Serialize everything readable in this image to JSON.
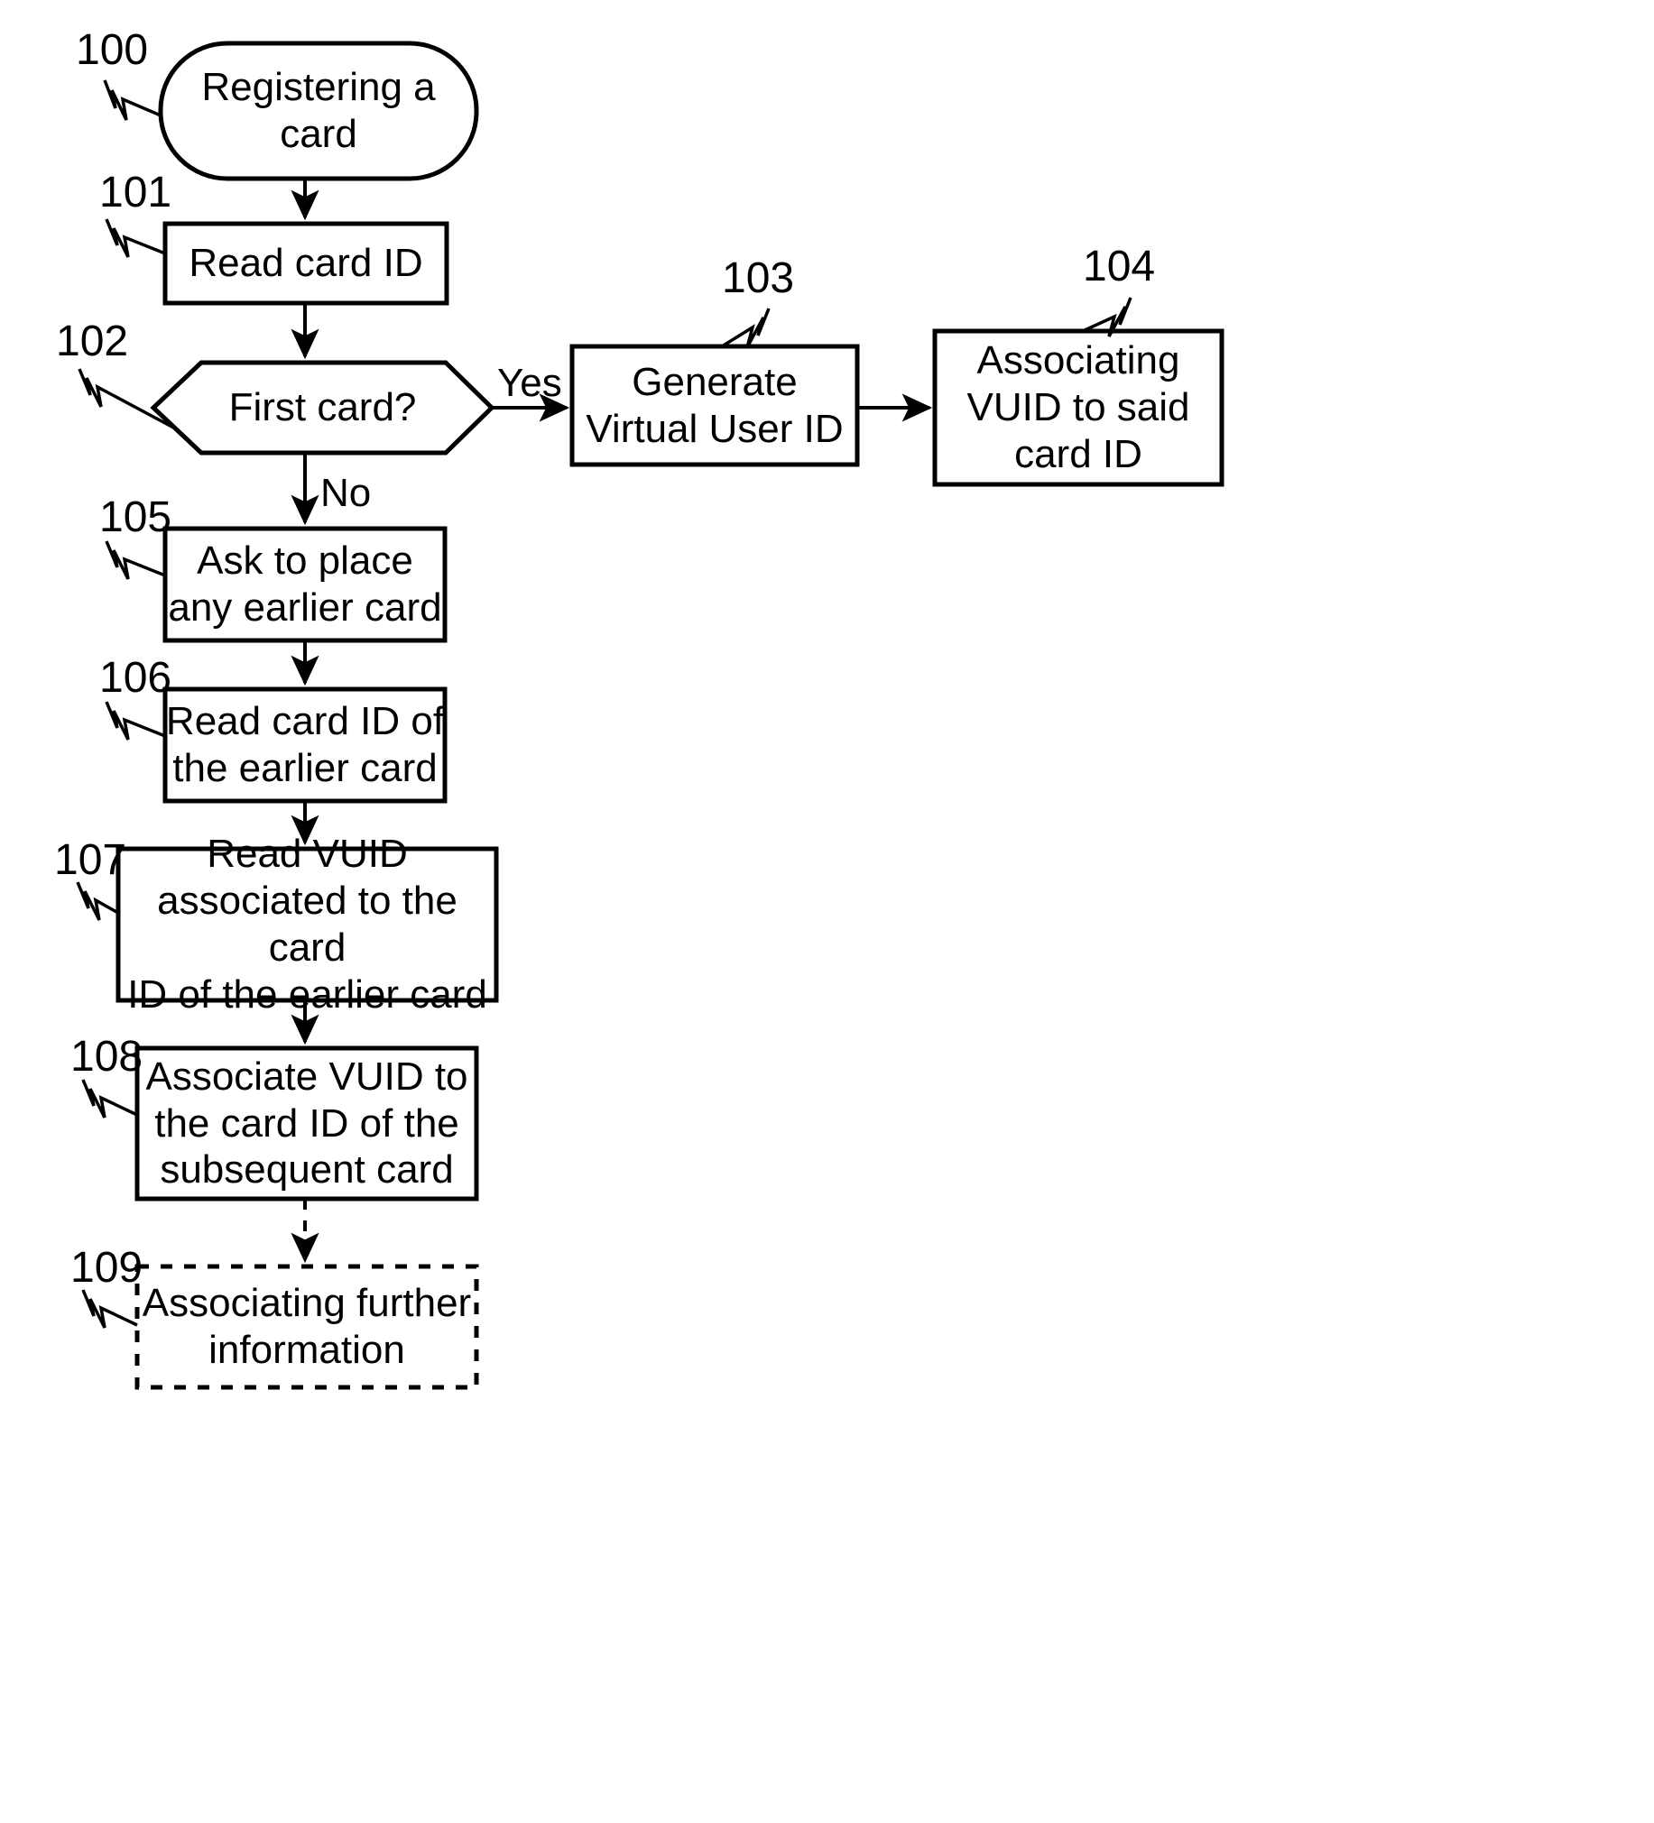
{
  "diagram": {
    "title": "Registering a card",
    "type": "flowchart",
    "background_color": "#ffffff",
    "line_color": "#000000",
    "nodes": [
      {
        "ref": "100",
        "shape": "rounded-terminator",
        "label": "Registering a card",
        "border": "solid"
      },
      {
        "ref": "101",
        "shape": "rectangle",
        "label": "Read card ID",
        "border": "solid"
      },
      {
        "ref": "102",
        "shape": "hexagon-decision",
        "label": "First card?",
        "border": "solid"
      },
      {
        "ref": "103",
        "shape": "rectangle",
        "label": "Generate\nVirtual User ID",
        "border": "solid"
      },
      {
        "ref": "104",
        "shape": "rectangle",
        "label": "Associating\nVUID to said\ncard ID",
        "border": "solid"
      },
      {
        "ref": "105",
        "shape": "rectangle",
        "label": "Ask to place\nany earlier card",
        "border": "solid"
      },
      {
        "ref": "106",
        "shape": "rectangle",
        "label": "Read card ID of\nthe earlier card",
        "border": "solid"
      },
      {
        "ref": "107",
        "shape": "rectangle",
        "label": "Read VUID\nassociated to the card\nID of the earlier card",
        "border": "solid"
      },
      {
        "ref": "108",
        "shape": "rectangle",
        "label": "Associate VUID to\nthe card ID of the\nsubsequent card",
        "border": "solid"
      },
      {
        "ref": "109",
        "shape": "rectangle",
        "label": "Associating further\ninformation",
        "border": "dashed"
      }
    ],
    "edge_labels": {
      "yes": "Yes",
      "no": "No"
    },
    "edges": [
      {
        "from": "100",
        "to": "101",
        "label": "",
        "style": "solid"
      },
      {
        "from": "101",
        "to": "102",
        "label": "",
        "style": "solid"
      },
      {
        "from": "102",
        "to": "103",
        "label": "Yes",
        "style": "solid"
      },
      {
        "from": "103",
        "to": "104",
        "label": "",
        "style": "solid"
      },
      {
        "from": "102",
        "to": "105",
        "label": "No",
        "style": "solid"
      },
      {
        "from": "105",
        "to": "106",
        "label": "",
        "style": "solid"
      },
      {
        "from": "106",
        "to": "107",
        "label": "",
        "style": "solid"
      },
      {
        "from": "107",
        "to": "108",
        "label": "",
        "style": "solid"
      },
      {
        "from": "108",
        "to": "109",
        "label": "",
        "style": "dashed"
      }
    ]
  }
}
